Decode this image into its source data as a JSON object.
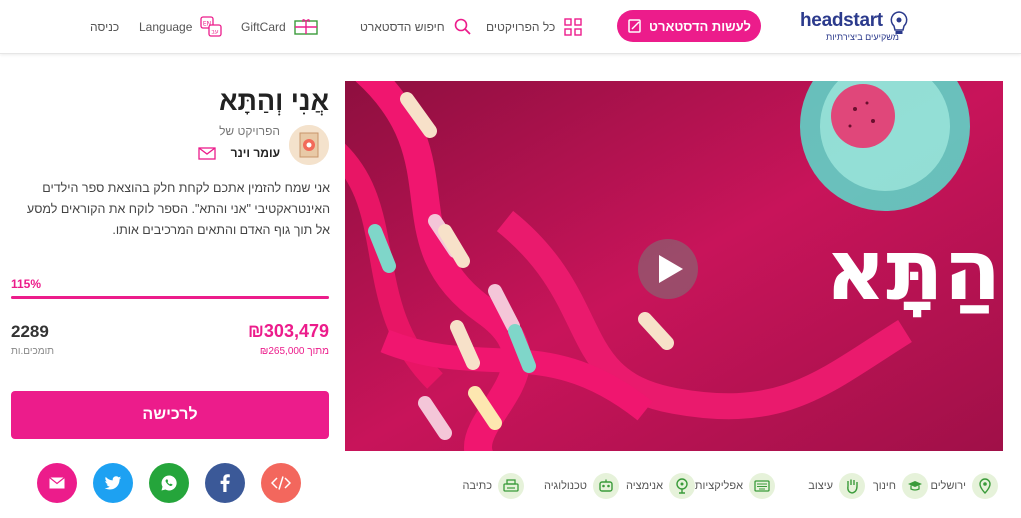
{
  "header": {
    "logo_text": "headstart",
    "logo_sub": "משקיעים ביצירתיות",
    "cta_label": "לעשות הדסטארט",
    "nav": {
      "all_projects": "כל הפרויקטים",
      "search": "חיפוש הדסטארט",
      "giftcard": "GiftCard",
      "language": "Language",
      "login": "כניסה"
    },
    "language_badge_top": "EN",
    "language_badge_bottom": "עב"
  },
  "project": {
    "title": "אֲנִי וְהַתָּא",
    "creator_label": "הפרויקט של",
    "creator_name": "עומר וינר",
    "description": "אני שמח להזמין אתכם לקחת חלק בהוצאת ספר הילדים האינטראקטיבי \"אני והתא\". הספר לוקח את הקוראים למסע אל תוך גוף האדם והתאים המרכיבים אותו.",
    "percent": "115%",
    "progress_fraction": 1.0,
    "raised": "₪303,479",
    "goal": "מתוך ₪265,000",
    "supporters_count": "2289",
    "supporters_label": "תומכים.ות",
    "buy_label": "לרכישה",
    "hero_title": "אֲנִי וְהַתָּא"
  },
  "share": [
    {
      "name": "embed",
      "color": "#f3675d",
      "icon": "code-icon"
    },
    {
      "name": "facebook",
      "color": "#3b5998",
      "icon": "facebook-icon"
    },
    {
      "name": "whatsapp",
      "color": "#25a53b",
      "icon": "whatsapp-icon"
    },
    {
      "name": "twitter",
      "color": "#1da1f2",
      "icon": "twitter-icon"
    },
    {
      "name": "email",
      "color": "#ec1c8b",
      "icon": "email-icon"
    }
  ],
  "categories": [
    {
      "label": "ירושלים",
      "icon": "map-pin-icon"
    },
    {
      "label": "חינוך",
      "icon": "graduation-cap-icon"
    },
    {
      "label": "עיצוב",
      "icon": "hand-icon"
    },
    {
      "label": "אפליקציות",
      "icon": "keyboard-icon"
    },
    {
      "label": "אנימציה",
      "icon": "film-reel-icon"
    },
    {
      "label": "טכנולוגיה",
      "icon": "robot-icon"
    },
    {
      "label": "כתיבה",
      "icon": "typewriter-icon"
    }
  ],
  "colors": {
    "brand_pink": "#ec1c8b",
    "brand_blue": "#2b3a8c",
    "hero_bg": "#b5124e"
  }
}
